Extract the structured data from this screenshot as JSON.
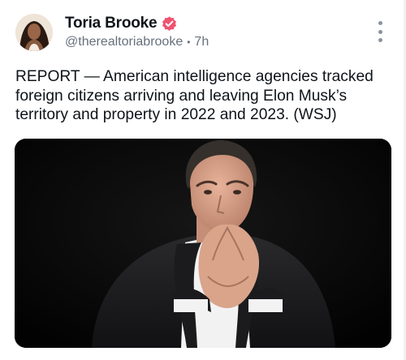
{
  "post": {
    "author": {
      "display_name": "Toria Brooke",
      "handle": "@therealtoriabrooke",
      "verified": true,
      "verified_color": "#f0536f"
    },
    "timestamp": "7h",
    "separator": "•",
    "text": "REPORT — American intelligence agencies tracked foreign citizens arriving and leaving Elon Musk’s territory and property in 2022 and 2023. (WSJ)",
    "media": {
      "type": "photo"
    },
    "icons": {
      "more": "more-vertical-icon",
      "verified": "verified-badge-icon"
    }
  }
}
